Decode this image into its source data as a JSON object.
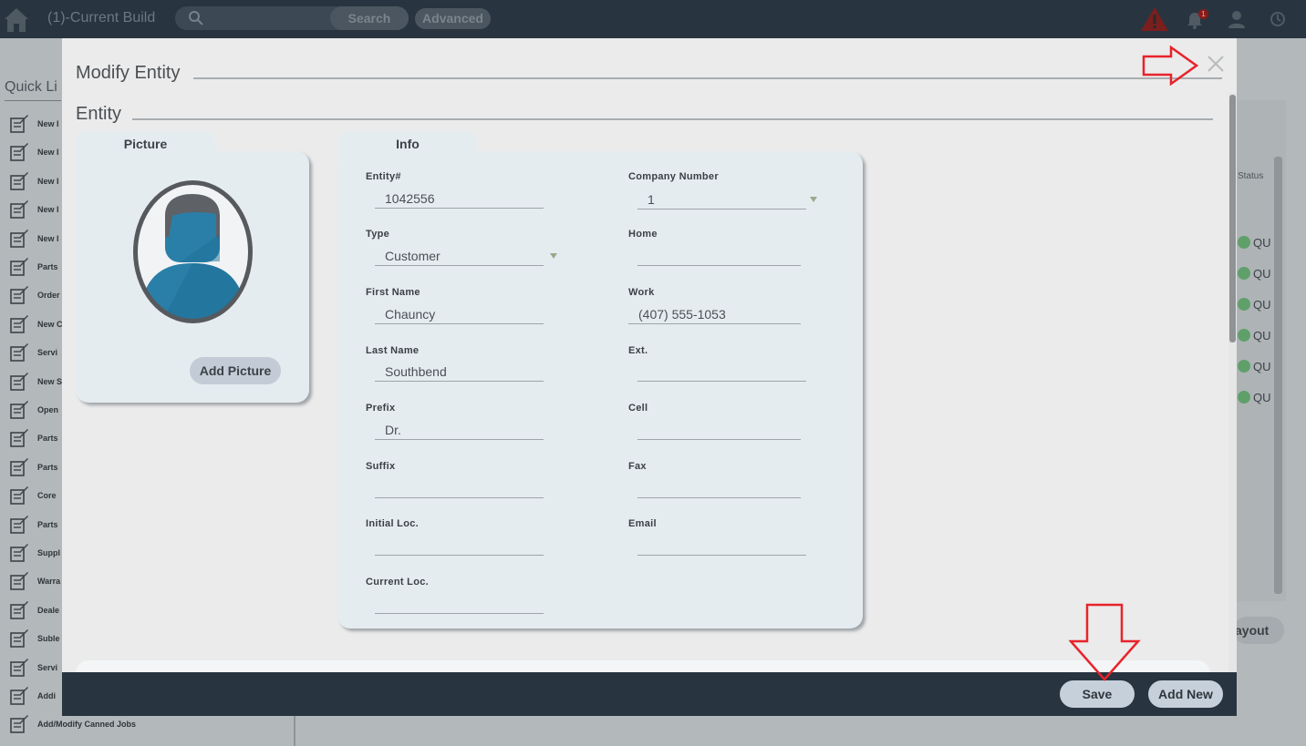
{
  "app": {
    "title": "(1)-Current Build",
    "search_label": "Search",
    "advanced_label": "Advanced",
    "notification_count": "1"
  },
  "quick_links": {
    "title": "Quick Li",
    "items": [
      {
        "label": "New I"
      },
      {
        "label": "New I"
      },
      {
        "label": "New I"
      },
      {
        "label": "New I"
      },
      {
        "label": "New I"
      },
      {
        "label": "Parts"
      },
      {
        "label": "Order"
      },
      {
        "label": "New C"
      },
      {
        "label": "Servi"
      },
      {
        "label": "New S"
      },
      {
        "label": "Open"
      },
      {
        "label": "Parts"
      },
      {
        "label": "Parts"
      },
      {
        "label": "Core"
      },
      {
        "label": "Parts"
      },
      {
        "label": "Suppl"
      },
      {
        "label": "Warra"
      },
      {
        "label": "Deale"
      },
      {
        "label": "Suble"
      },
      {
        "label": "Servi"
      },
      {
        "label": "Addi"
      },
      {
        "label": "Add/Modify Canned Jobs"
      }
    ]
  },
  "background_table": {
    "status_header": "Status",
    "rows": [
      "QU",
      "QU",
      "QU",
      "QU",
      "QU",
      "QU"
    ],
    "layout_label": "ayout"
  },
  "modal": {
    "title": "Modify Entity",
    "section_title": "Entity",
    "picture_tab": "Picture",
    "add_picture_label": "Add Picture",
    "info_tab": "Info",
    "fields": {
      "entity_no": {
        "label": "Entity#",
        "value": "1042556"
      },
      "company_number": {
        "label": "Company Number",
        "value": "1"
      },
      "type": {
        "label": "Type",
        "value": "Customer"
      },
      "home": {
        "label": "Home",
        "value": ""
      },
      "first_name": {
        "label": "First Name",
        "value": "Chauncy"
      },
      "work": {
        "label": "Work",
        "value": "(407) 555-1053"
      },
      "last_name": {
        "label": "Last Name",
        "value": "Southbend"
      },
      "ext": {
        "label": "Ext.",
        "value": ""
      },
      "prefix": {
        "label": "Prefix",
        "value": "Dr."
      },
      "cell": {
        "label": "Cell",
        "value": ""
      },
      "suffix": {
        "label": "Suffix",
        "value": ""
      },
      "fax": {
        "label": "Fax",
        "value": ""
      },
      "initial_loc": {
        "label": "Initial Loc.",
        "value": ""
      },
      "email": {
        "label": "Email",
        "value": ""
      },
      "current_loc": {
        "label": "Current Loc.",
        "value": ""
      }
    },
    "footer": {
      "save_label": "Save",
      "add_new_label": "Add New"
    }
  },
  "colors": {
    "topbar": "#283540",
    "card_bg": "#e5ecf0",
    "avatar_blue": "#1f7fa8",
    "annotation_red": "#e8232b"
  }
}
